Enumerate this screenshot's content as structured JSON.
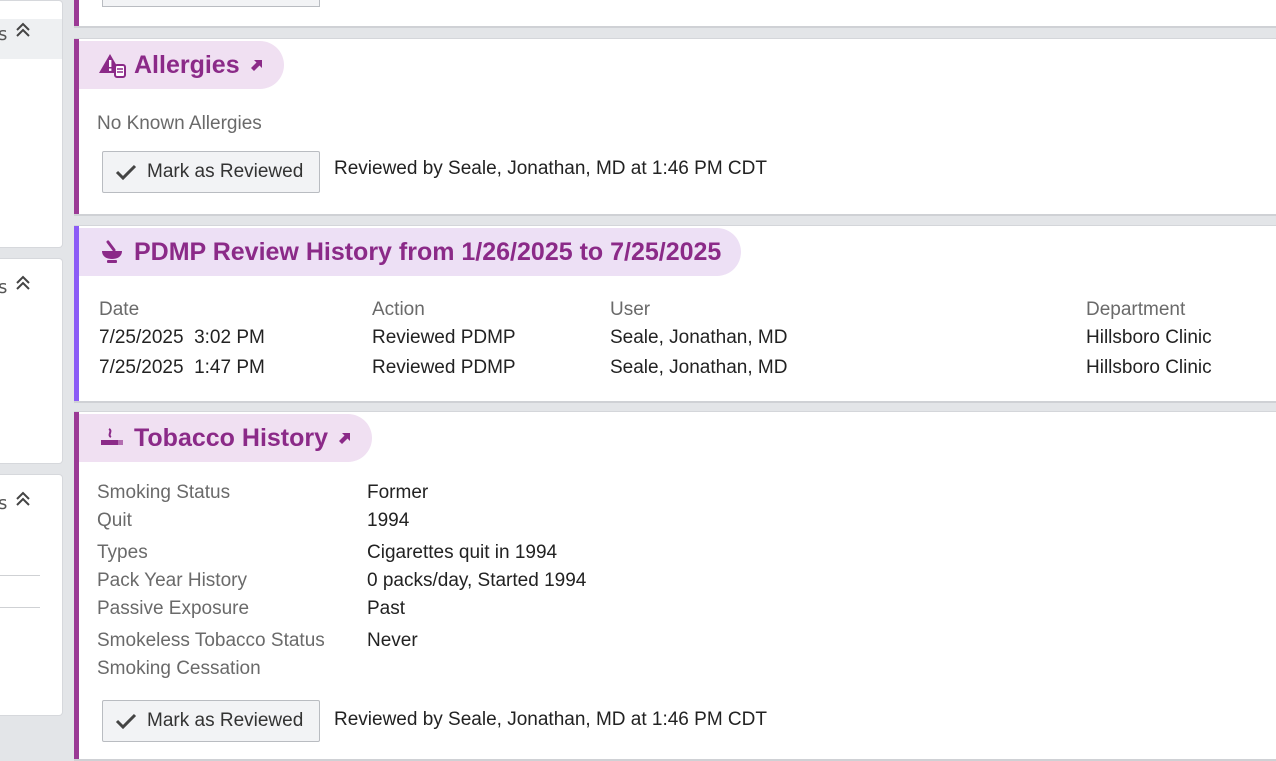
{
  "sidebar": {
    "sections": [
      {
        "header_fragment": "s"
      },
      {
        "header_fragment": "s"
      },
      {
        "header_fragment": "s"
      }
    ]
  },
  "colors": {
    "accent_purple": "#8b2a88",
    "pill_bg": "#f0e0f2",
    "bar_allergies": "#9b3a95",
    "bar_pdmp": "#8b5cf6",
    "bar_tobacco": "#9b3a95"
  },
  "allergies": {
    "title": "Allergies",
    "icon": "allergy-alert-icon",
    "status_text": "No Known Allergies",
    "mark_reviewed_label": "Mark as Reviewed",
    "reviewed_text": "Reviewed by Seale, Jonathan, MD at 1:46 PM CDT"
  },
  "pdmp": {
    "title": "PDMP Review History from 1/26/2025 to 7/25/2025",
    "icon": "mortar-pestle-icon",
    "columns": [
      "Date",
      "Action",
      "User",
      "Department"
    ],
    "rows": [
      {
        "date": "7/25/2025  3:02 PM",
        "action": "Reviewed PDMP",
        "user": "Seale, Jonathan, MD",
        "department": "Hillsboro Clinic"
      },
      {
        "date": "7/25/2025  1:47 PM",
        "action": "Reviewed PDMP",
        "user": "Seale, Jonathan, MD",
        "department": "Hillsboro Clinic"
      }
    ]
  },
  "tobacco": {
    "title": "Tobacco History",
    "icon": "cigarette-icon",
    "fields": [
      {
        "label": "Smoking Status",
        "value": "Former"
      },
      {
        "label": "Quit",
        "value": "1994"
      },
      {
        "label": "Types",
        "value": "Cigarettes quit in 1994"
      },
      {
        "label": "Pack Year History",
        "value": "0 packs/day, Started 1994"
      },
      {
        "label": "Passive Exposure",
        "value": "Past"
      },
      {
        "label": "Smokeless Tobacco Status",
        "value": "Never"
      },
      {
        "label": "Smoking Cessation",
        "value": ""
      }
    ],
    "mark_reviewed_label": "Mark as Reviewed",
    "reviewed_text": "Reviewed by Seale, Jonathan, MD at 1:46 PM CDT"
  }
}
